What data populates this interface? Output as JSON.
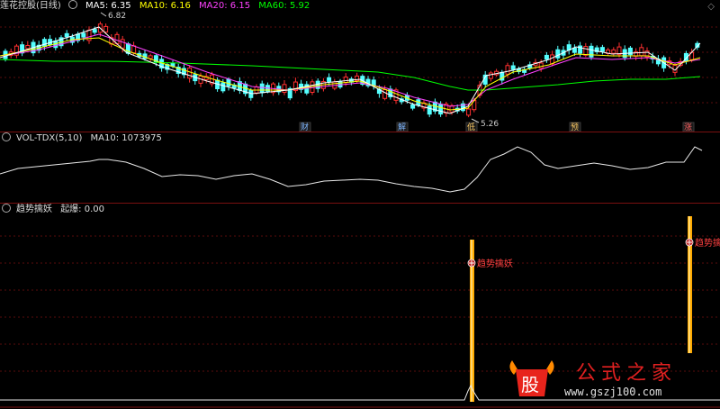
{
  "main": {
    "title": "莲花控股(日线)",
    "indicators": [
      {
        "label": "MA5: 6.35",
        "color": "#ffffff"
      },
      {
        "label": "MA10: 6.16",
        "color": "#ffff00"
      },
      {
        "label": "MA20: 6.15",
        "color": "#ff40ff"
      },
      {
        "label": "MA60: 5.92",
        "color": "#00ff00"
      }
    ],
    "high_label": "6.82",
    "low_label": "5.26",
    "markers": [
      "财",
      "解",
      "低",
      "预",
      "涨"
    ]
  },
  "vol": {
    "title": "VOL-TDX(5,10)",
    "ma10_label": "MA10: 1073975"
  },
  "signal": {
    "title": "趋势擒妖",
    "value_label": "起爆: 0.00",
    "annotations": [
      "趋势擒妖",
      "趋势擒妖"
    ]
  },
  "logo": {
    "text": "公式之家",
    "url": "www.gszj100.com",
    "glyph": "股"
  },
  "colors": {
    "up": "#ff3030",
    "down": "#54ffff",
    "ma5": "#ffffff",
    "ma10": "#ffff00",
    "ma20": "#ff40ff",
    "ma60": "#00ff00",
    "signal": "#ffaa00"
  },
  "icons": [
    "chip-icon",
    "collapse-icon",
    "signal-marker-icon",
    "bull-logo-icon"
  ]
}
